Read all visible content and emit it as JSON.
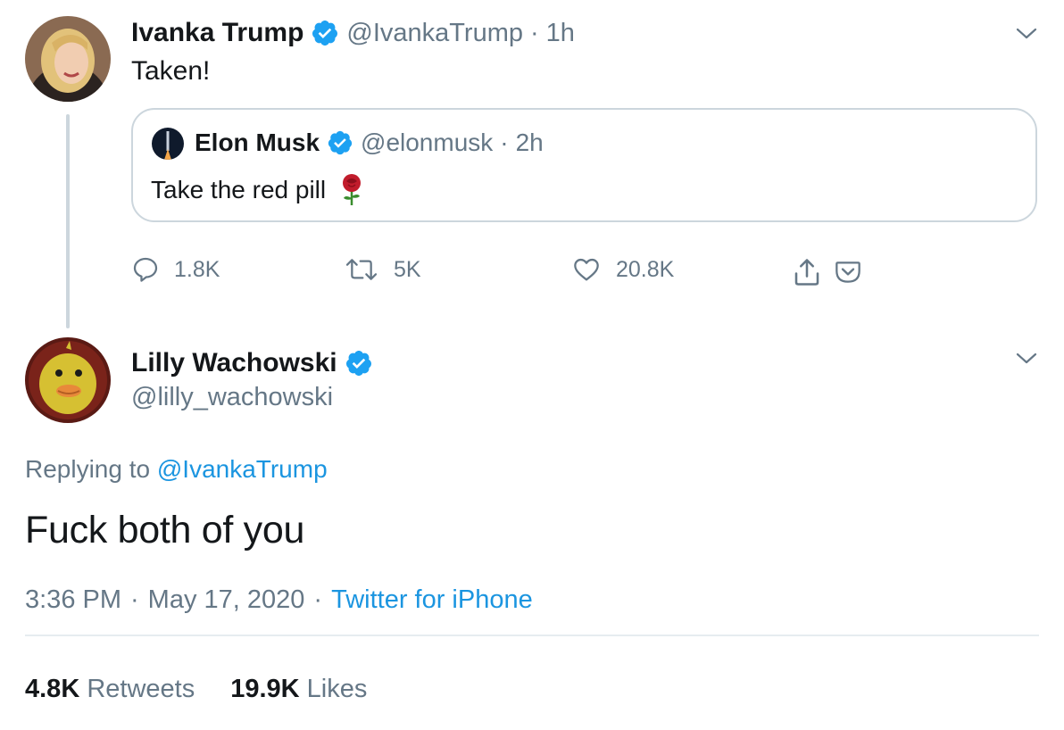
{
  "tweet1": {
    "name": "Ivanka Trump",
    "handle": "@IvankaTrump",
    "time": "1h",
    "text": "Taken!",
    "quote": {
      "name": "Elon Musk",
      "handle": "@elonmusk",
      "time": "2h",
      "text": "Take the red pill",
      "emoji_icon": "rose-icon"
    },
    "actions": {
      "replies": "1.8K",
      "retweets": "5K",
      "likes": "20.8K"
    }
  },
  "tweet2": {
    "name": "Lilly Wachowski",
    "handle": "@lilly_wachowski",
    "replying_label": "Replying to",
    "replying_to": "@IvankaTrump",
    "text": "Fuck both of you",
    "time": "3:36 PM",
    "date": "May 17, 2020",
    "source": "Twitter for iPhone",
    "retweets_count": "4.8K",
    "retweets_label": "Retweets",
    "likes_count": "19.9K",
    "likes_label": "Likes"
  },
  "separator": "·",
  "colors": {
    "verified": "#1da1f2",
    "link": "#1b95e0",
    "secondary_text": "#657786",
    "border": "#ccd6dd"
  }
}
